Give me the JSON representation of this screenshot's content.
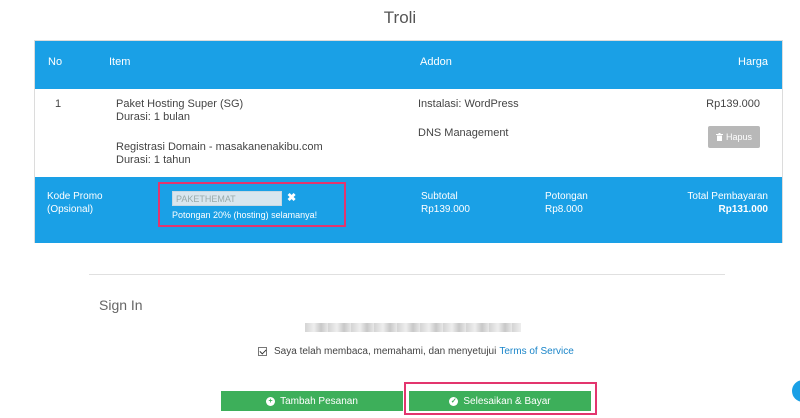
{
  "page": {
    "title": "Troli"
  },
  "cart": {
    "headers": {
      "no": "No",
      "item": "Item",
      "addon": "Addon",
      "price": "Harga"
    },
    "row": {
      "no": "1",
      "item_name": "Paket Hosting Super (SG)",
      "item_duration": "Durasi: 1 bulan",
      "domain_name": "Registrasi Domain - masakanenakibu.com",
      "domain_duration": "Durasi: 1 tahun",
      "addon_1": "Instalasi: WordPress",
      "addon_2": "DNS Management",
      "price": "Rp139.000",
      "remove_label": "Hapus"
    },
    "footer": {
      "promo_label_1": "Kode Promo",
      "promo_label_2": "(Opsional)",
      "promo_code": "PAKETHEMAT",
      "promo_message": "Potongan 20% (hosting) selamanya!",
      "subtotal_label": "Subtotal",
      "subtotal_value": "Rp139.000",
      "discount_label": "Potongan",
      "discount_value": "Rp8.000",
      "total_label": "Total Pembayaran",
      "total_value": "Rp131.000"
    }
  },
  "signin": {
    "title": "Sign In",
    "tos_text": "Saya telah membaca, memahami, dan menyetujui",
    "tos_link": "Terms of Service"
  },
  "actions": {
    "add_order": "Tambah Pesanan",
    "checkout": "Selesaikan & Bayar"
  },
  "colors": {
    "accent": "#1aa0e6",
    "button_green": "#3daf5a",
    "highlight": "#e3356e"
  },
  "icons": {
    "remove": "trash-icon",
    "promo_clear": "close-icon",
    "add_order": "plus-circle-icon",
    "checkout": "check-circle-icon"
  }
}
